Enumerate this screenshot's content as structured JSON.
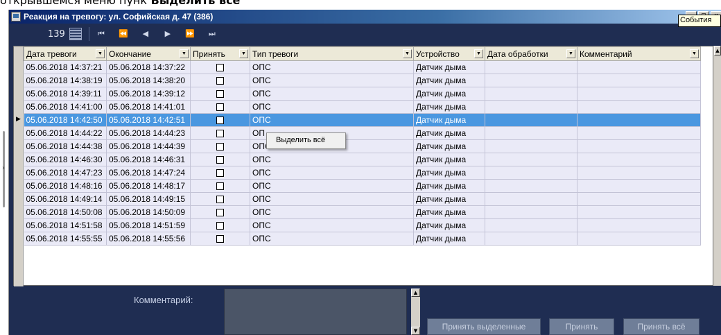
{
  "page_top_text": {
    "normal": "открывшемся меню пунк",
    "bold": " Выделить всё"
  },
  "window": {
    "title": "Реакция на тревогу: ул. Софийская д. 47 (386)",
    "buttons": {
      "minimize": "_",
      "maximize": "□",
      "close": "×"
    }
  },
  "tooltip": "События",
  "toolbar": {
    "record_count": "139",
    "nav": {
      "first": "⏮",
      "prev_page": "⏪",
      "prev": "◀",
      "next": "▶",
      "next_page": "⏩",
      "last": "⏭"
    }
  },
  "table": {
    "columns": [
      "Дата тревоги",
      "Окончание",
      "Принять",
      "Тип тревоги",
      "Устройство",
      "Дата обработки",
      "Комментарий"
    ],
    "selected_row": 4,
    "rows": [
      {
        "start": "05.06.2018 14:37:21",
        "end": "05.06.2018 14:37:22",
        "accepted": false,
        "type": "ОПС",
        "device": "Датчик дыма",
        "processed": "",
        "comment": ""
      },
      {
        "start": "05.06.2018 14:38:19",
        "end": "05.06.2018 14:38:20",
        "accepted": false,
        "type": "ОПС",
        "device": "Датчик дыма",
        "processed": "",
        "comment": ""
      },
      {
        "start": "05.06.2018 14:39:11",
        "end": "05.06.2018 14:39:12",
        "accepted": false,
        "type": "ОПС",
        "device": "Датчик дыма",
        "processed": "",
        "comment": ""
      },
      {
        "start": "05.06.2018 14:41:00",
        "end": "05.06.2018 14:41:01",
        "accepted": false,
        "type": "ОПС",
        "device": "Датчик дыма",
        "processed": "",
        "comment": ""
      },
      {
        "start": "05.06.2018 14:42:50",
        "end": "05.06.2018 14:42:51",
        "accepted": false,
        "type": "ОПС",
        "device": "Датчик дыма",
        "processed": "",
        "comment": ""
      },
      {
        "start": "05.06.2018 14:44:22",
        "end": "05.06.2018 14:44:23",
        "accepted": false,
        "type": "ОП",
        "device": "Датчик дыма",
        "processed": "",
        "comment": ""
      },
      {
        "start": "05.06.2018 14:44:38",
        "end": "05.06.2018 14:44:39",
        "accepted": false,
        "type": "ОПС",
        "device": "Датчик дыма",
        "processed": "",
        "comment": ""
      },
      {
        "start": "05.06.2018 14:46:30",
        "end": "05.06.2018 14:46:31",
        "accepted": false,
        "type": "ОПС",
        "device": "Датчик дыма",
        "processed": "",
        "comment": ""
      },
      {
        "start": "05.06.2018 14:47:23",
        "end": "05.06.2018 14:47:24",
        "accepted": false,
        "type": "ОПС",
        "device": "Датчик дыма",
        "processed": "",
        "comment": ""
      },
      {
        "start": "05.06.2018 14:48:16",
        "end": "05.06.2018 14:48:17",
        "accepted": false,
        "type": "ОПС",
        "device": "Датчик дыма",
        "processed": "",
        "comment": ""
      },
      {
        "start": "05.06.2018 14:49:14",
        "end": "05.06.2018 14:49:15",
        "accepted": false,
        "type": "ОПС",
        "device": "Датчик дыма",
        "processed": "",
        "comment": ""
      },
      {
        "start": "05.06.2018 14:50:08",
        "end": "05.06.2018 14:50:09",
        "accepted": false,
        "type": "ОПС",
        "device": "Датчик дыма",
        "processed": "",
        "comment": ""
      },
      {
        "start": "05.06.2018 14:51:58",
        "end": "05.06.2018 14:51:59",
        "accepted": false,
        "type": "ОПС",
        "device": "Датчик дыма",
        "processed": "",
        "comment": ""
      },
      {
        "start": "05.06.2018 14:55:55",
        "end": "05.06.2018 14:55:56",
        "accepted": false,
        "type": "ОПС",
        "device": "Датчик дыма",
        "processed": "",
        "comment": ""
      }
    ]
  },
  "context_menu": {
    "select_all": "Выделить всё"
  },
  "bottom": {
    "comment_label": "Комментарий:",
    "comment_value": "",
    "accept_selected": "Принять выделенные",
    "accept": "Принять",
    "accept_all": "Принять всё"
  },
  "colors": {
    "panel": "#1f2d52",
    "row": "#eaeaf7",
    "selected_row": "#4a97e0",
    "button": "#6f7e98"
  }
}
